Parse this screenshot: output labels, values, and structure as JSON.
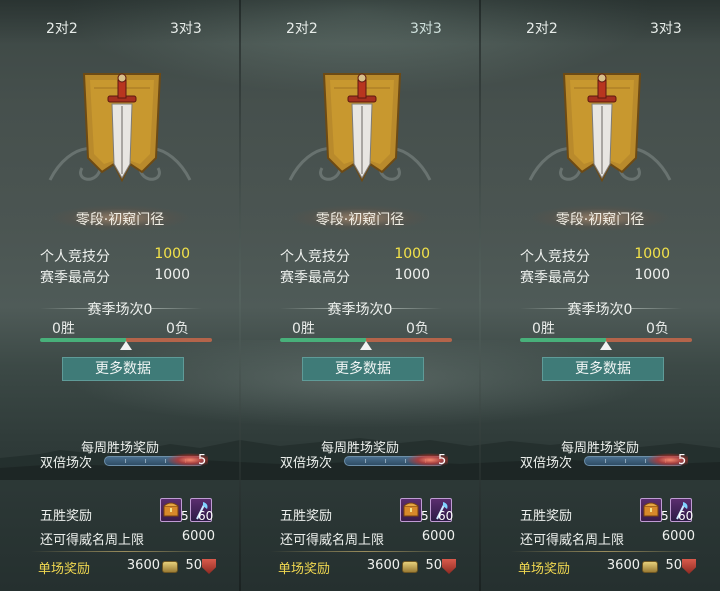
{
  "tabs": {
    "left": "2对2",
    "right": "3对3"
  },
  "panels": [
    {
      "rank_name": "零段·初窥门径",
      "personal_score_label": "个人竞技分",
      "personal_score": "1000",
      "season_high_label": "赛季最高分",
      "season_high": "1000",
      "season_matches": "赛季场次0",
      "wins": "0胜",
      "losses": "0负",
      "win_ratio": 0.5,
      "more_data": "更多数据",
      "weekly_reward_title": "每周胜场奖励",
      "double_label": "双倍场次",
      "double_max": "5",
      "five_win_label": "五胜奖励",
      "item1_count": "5",
      "item2_count": "60",
      "weekly_cap_label": "还可得威名周上限",
      "weekly_cap_value": "6000",
      "single_reward_label": "单场奖励",
      "single_coin": "3600",
      "single_shield": "50"
    },
    {
      "rank_name": "零段·初窥门径",
      "personal_score_label": "个人竞技分",
      "personal_score": "1000",
      "season_high_label": "赛季最高分",
      "season_high": "1000",
      "season_matches": "赛季场次0",
      "wins": "0胜",
      "losses": "0负",
      "win_ratio": 0.5,
      "more_data": "更多数据",
      "weekly_reward_title": "每周胜场奖励",
      "double_label": "双倍场次",
      "double_max": "5",
      "five_win_label": "五胜奖励",
      "item1_count": "5",
      "item2_count": "60",
      "weekly_cap_label": "还可得威名周上限",
      "weekly_cap_value": "6000",
      "single_reward_label": "单场奖励",
      "single_coin": "3600",
      "single_shield": "50"
    },
    {
      "rank_name": "零段·初窥门径",
      "personal_score_label": "个人竞技分",
      "personal_score": "1000",
      "season_high_label": "赛季最高分",
      "season_high": "1000",
      "season_matches": "赛季场次0",
      "wins": "0胜",
      "losses": "0负",
      "win_ratio": 0.5,
      "more_data": "更多数据",
      "weekly_reward_title": "每周胜场奖励",
      "double_label": "双倍场次",
      "double_max": "5",
      "five_win_label": "五胜奖励",
      "item1_count": "5",
      "item2_count": "60",
      "weekly_cap_label": "还可得威名周上限",
      "weekly_cap_value": "6000",
      "single_reward_label": "单场奖励",
      "single_coin": "3600",
      "single_shield": "50"
    }
  ],
  "colors": {
    "score_highlight": "#f3e24a",
    "single_reward": "#f0d850",
    "win_bar": "#48b07a",
    "loss_bar": "#b4644a",
    "button": "#3f7b78"
  },
  "icons": [
    "banner-sword-emblem-icon",
    "treasure-chest-icon",
    "axe-item-icon",
    "coin-icon",
    "shield-icon"
  ]
}
